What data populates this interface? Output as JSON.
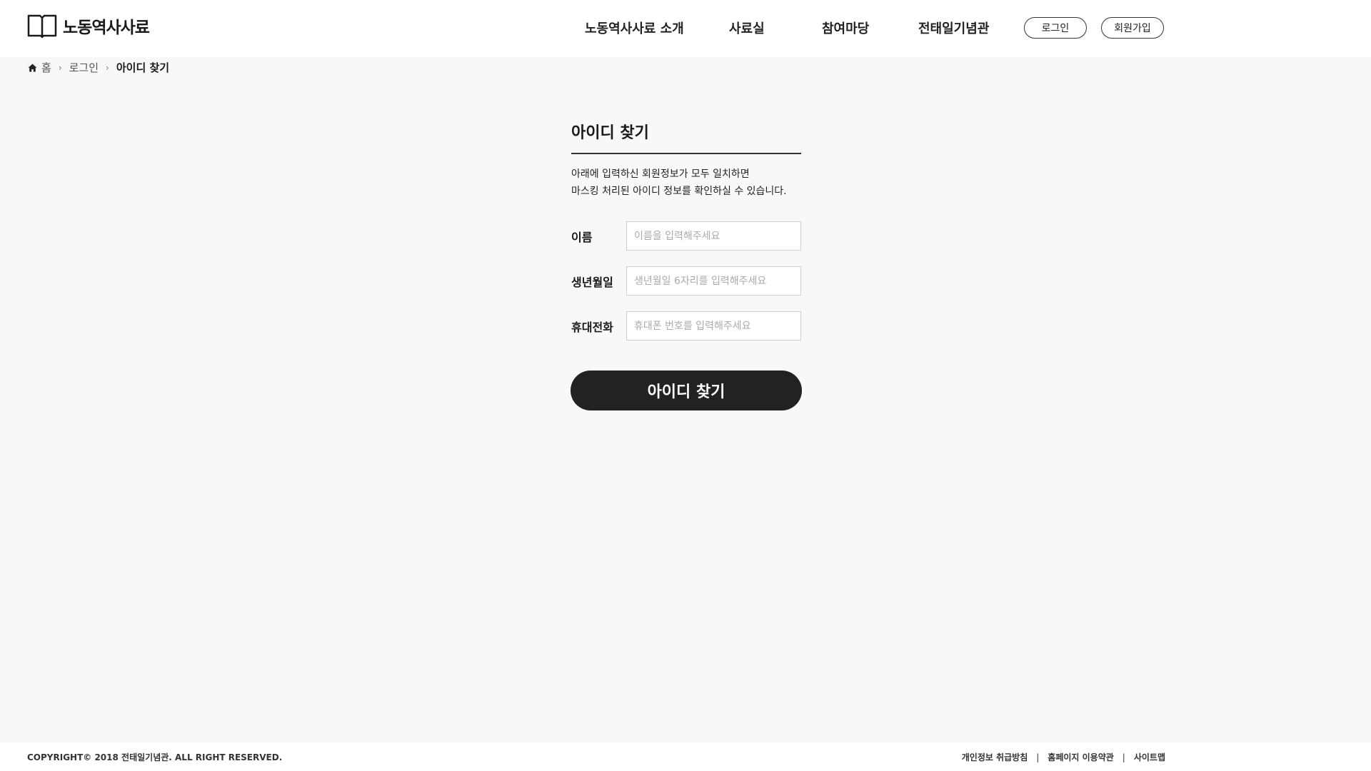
{
  "header": {
    "logo_text": "노동역사사료",
    "nav": [
      {
        "label": "노동역사사료 소개"
      },
      {
        "label": "사료실"
      },
      {
        "label": "참여마당"
      },
      {
        "label": "전태일기념관"
      }
    ],
    "login_label": "로그인",
    "signup_label": "회원가입"
  },
  "breadcrumb": {
    "home": "홈",
    "login": "로그인",
    "current": "아이디 찾기"
  },
  "form": {
    "title": "아이디 찾기",
    "desc_line1": "아래에 입력하신 회원정보가 모두 일치하면",
    "desc_line2": "마스킹 처리된 아이디 정보를 확인하실 수 있습니다.",
    "fields": [
      {
        "label": "이름",
        "placeholder": "이름을 입력해주세요",
        "value": ""
      },
      {
        "label": "생년월일",
        "placeholder": "생년월일 6자리를 입력해주세요",
        "value": ""
      },
      {
        "label": "휴대전화",
        "placeholder": "휴대폰 번호를 입력해주세요",
        "value": ""
      }
    ],
    "submit_label": "아이디 찾기"
  },
  "footer": {
    "copyright": "COPYRIGHT© 2018 전태일기념관. ALL RIGHT RESERVED.",
    "links": [
      {
        "label": "개인정보 취급방침"
      },
      {
        "label": "홈페이지 이용약관"
      },
      {
        "label": "사이트맵"
      }
    ],
    "separator": "|"
  },
  "colors": {
    "background": "#f9f8f8",
    "header_bg": "#ffffff",
    "button_dark": "#222222",
    "text": "#1a1a1a"
  },
  "icons": {
    "logo": "open-book-icon",
    "home": "home-icon",
    "breadcrumb_separator": "chevron-right-icon"
  }
}
